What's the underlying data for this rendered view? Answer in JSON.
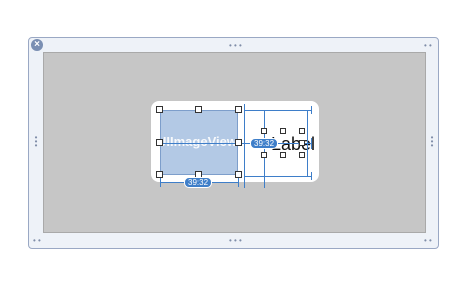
{
  "scene": {
    "close_glyph": "×",
    "dock_dots": "• • •",
    "corner_dots": "• •",
    "side_dots": "•\n•\n•"
  },
  "views": {
    "image_view_label": "UIImageView",
    "label_text": "Label",
    "width_badge": "39:32",
    "spacing_badge": "39:32"
  },
  "colors": {
    "selection_blue": "#3e7ec9",
    "canvas_gray": "#c6c6c6",
    "image_fill": "#b3c9e5"
  }
}
